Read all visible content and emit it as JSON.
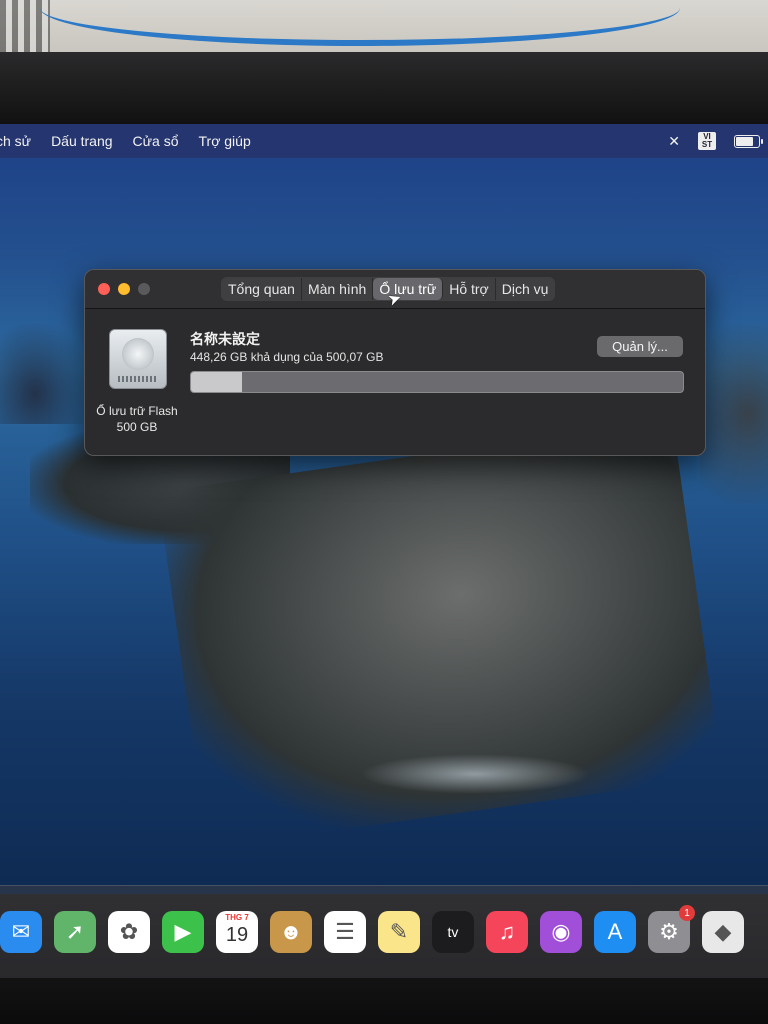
{
  "menubar": {
    "items": [
      "ch sử",
      "Dấu trang",
      "Cửa sổ",
      "Trợ giúp"
    ],
    "input_source": [
      "VI",
      "ST"
    ]
  },
  "window": {
    "tabs": [
      "Tổng quan",
      "Màn hình",
      "Ổ lưu trữ",
      "Hỗ trợ",
      "Dịch vụ"
    ],
    "active_tab": "Ổ lưu trữ",
    "drive_name": "名称未設定",
    "availability": "448,26 GB khả dụng của 500,07 GB",
    "manage_label": "Quản lý...",
    "drive_label_line1": "Ổ lưu trữ Flash",
    "drive_label_line2": "500 GB",
    "used_fraction": 0.104
  },
  "dock": {
    "apps": [
      {
        "name": "Mail",
        "icon": "mail-icon",
        "color": "#2b8cf0"
      },
      {
        "name": "Maps",
        "icon": "maps-icon",
        "color": "#61b56a"
      },
      {
        "name": "Photos",
        "icon": "photos-icon",
        "color": "#ffffff"
      },
      {
        "name": "FaceTime",
        "icon": "facetime-icon",
        "color": "#3cc24a"
      },
      {
        "name": "Calendar",
        "icon": "calendar-icon",
        "color": "#ffffff"
      },
      {
        "name": "Contacts",
        "icon": "contacts-icon",
        "color": "#c9974a"
      },
      {
        "name": "Reminders",
        "icon": "reminders-icon",
        "color": "#ffffff"
      },
      {
        "name": "Notes",
        "icon": "notes-icon",
        "color": "#fbe58a"
      },
      {
        "name": "TV",
        "icon": "apple-tv-icon",
        "color": "#1c1c1e"
      },
      {
        "name": "Music",
        "icon": "music-icon",
        "color": "#f5455b"
      },
      {
        "name": "Podcasts",
        "icon": "podcasts-icon",
        "color": "#a14fd9"
      },
      {
        "name": "App Store",
        "icon": "app-store-icon",
        "color": "#1f8ef3"
      },
      {
        "name": "System Preferences",
        "icon": "system-preferences-icon",
        "color": "#8e8e93"
      },
      {
        "name": "Roblox",
        "icon": "roblox-icon",
        "color": "#e8e8e8"
      }
    ],
    "calendar_month": "THG 7",
    "calendar_day": "19",
    "tv_label": "tv",
    "sysprefs_badge": "1"
  }
}
